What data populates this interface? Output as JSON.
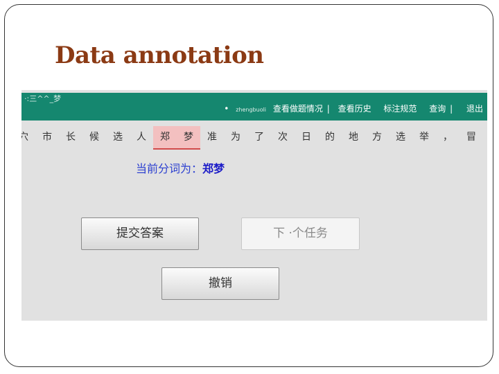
{
  "slide": {
    "title": "Data annotation"
  },
  "app": {
    "logo": "·:三^^_梦",
    "nav": {
      "bullet": "•",
      "user": "zhengbuoli",
      "items": [
        "查看做题情况",
        "查看历史",
        "标注规范",
        "查询",
        "退出"
      ],
      "sep": "|"
    },
    "characters": [
      "穴",
      "市",
      "长",
      "候",
      "选",
      "人",
      "郑",
      "梦",
      "准",
      "为",
      "了",
      "次",
      "日",
      "的",
      "地",
      "方",
      "选",
      "举",
      "，",
      "冒"
    ],
    "selected_indices": [
      6,
      7
    ],
    "segment": {
      "label": "当前分词为：",
      "value": "郑梦"
    },
    "buttons": {
      "submit": "提交答案",
      "next": "下 ·个任务",
      "undo": "撤销"
    }
  }
}
